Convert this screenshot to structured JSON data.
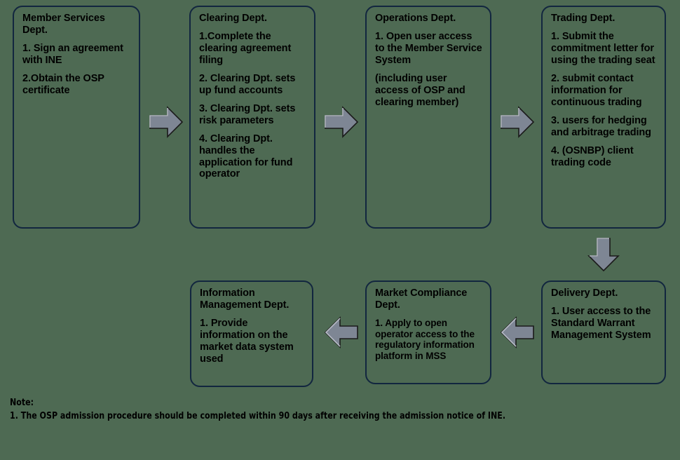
{
  "background_color": "#4e6a53",
  "box_border_color": "#12263f",
  "arrow_fill_color": "#7e8694",
  "arrow_stroke_color": "#1a1a1a",
  "text_color": "#000000",
  "boxes": [
    {
      "id": "member-services",
      "title": "Member Services Dept.",
      "items": [
        "1. Sign an agreement with INE",
        "2.Obtain the OSP certificate"
      ]
    },
    {
      "id": "clearing",
      "title": "Clearing Dept.",
      "items": [
        "1.Complete the clearing agreement filing",
        "2. Clearing Dpt. sets up fund accounts",
        "3. Clearing Dpt. sets risk parameters",
        "4. Clearing Dpt. handles the application for fund operator"
      ]
    },
    {
      "id": "operations",
      "title": "Operations Dept.",
      "items": [
        "1. Open user access to the Member Service System",
        "(including user access of OSP and clearing member)"
      ]
    },
    {
      "id": "trading",
      "title": "Trading Dept.",
      "items": [
        "1. Submit the commitment letter for using the trading seat",
        "2. submit contact information for continuous trading",
        "3. users for hedging and arbitrage trading",
        "4. (OSNBP) client trading code"
      ]
    },
    {
      "id": "delivery",
      "title": "Delivery Dept.",
      "items": [
        "1. User access to the Standard Warrant Management System"
      ]
    },
    {
      "id": "market-compliance",
      "title": "Market Compliance Dept.",
      "items": [
        "1. Apply to open operator access to the regulatory information platform in MSS"
      ]
    },
    {
      "id": "information-management",
      "title": "Information Management Dept.",
      "items": [
        "1. Provide information on the market data system used"
      ]
    }
  ],
  "arrows": [
    {
      "id": "arrow-member-to-clearing",
      "direction": "right"
    },
    {
      "id": "arrow-clearing-to-operations",
      "direction": "right"
    },
    {
      "id": "arrow-operations-to-trading",
      "direction": "right"
    },
    {
      "id": "arrow-trading-to-delivery",
      "direction": "down"
    },
    {
      "id": "arrow-delivery-to-compliance",
      "direction": "left"
    },
    {
      "id": "arrow-compliance-to-information",
      "direction": "left"
    }
  ],
  "note": {
    "label": "Note:",
    "line1": "1. The OSP admission procedure should be completed within 90 days after receiving the admission notice of INE."
  }
}
